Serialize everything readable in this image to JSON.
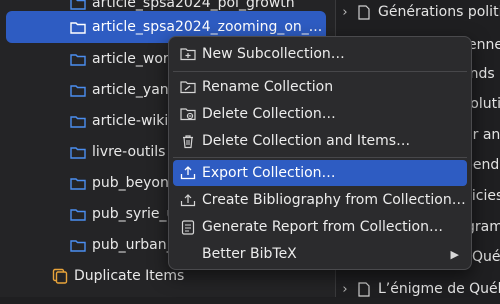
{
  "tree": {
    "items": [
      {
        "label": "article_spsa2024_pol_growth"
      },
      {
        "label": "article_spsa2024_zooming_on_..."
      },
      {
        "label": "article_work"
      },
      {
        "label": "article_yann"
      },
      {
        "label": "article-wikip"
      },
      {
        "label": "livre-outils"
      },
      {
        "label": "pub_beyond"
      },
      {
        "label": "pub_syrie_u"
      },
      {
        "label": "pub_urban_p"
      }
    ],
    "duplicate_items": "Duplicate Items"
  },
  "context_menu": {
    "items": [
      {
        "label": "New Subcollection…",
        "icon": "new-folder-icon"
      },
      {
        "label": "Rename Collection",
        "icon": "rename-folder-icon"
      },
      {
        "label": "Delete Collection…",
        "icon": "delete-folder-icon"
      },
      {
        "label": "Delete Collection and Items…",
        "icon": "trash-icon"
      },
      {
        "label": "Export Collection…",
        "icon": "export-icon"
      },
      {
        "label": "Create Bibliography from Collection…",
        "icon": "bibliography-icon"
      },
      {
        "label": "Generate Report from Collection…",
        "icon": "report-icon"
      },
      {
        "label": "Better BibTeX",
        "icon": ""
      }
    ],
    "highlighted": "Export Collection…"
  },
  "items_pane": {
    "first": "Générations politic",
    "frag1": "ennes",
    "frag2": "ends",
    "frag3": "volutic",
    "frag4": "er anc",
    "frag5": "pende",
    "frag6": "licies",
    "frag7": "gram",
    "frag8": "Qué",
    "last": "L’énigme de Québe"
  },
  "colors": {
    "selection": "#2e5cc2",
    "folder_blue": "#4b8ef0",
    "duplicate_orange": "#e8a33a"
  }
}
